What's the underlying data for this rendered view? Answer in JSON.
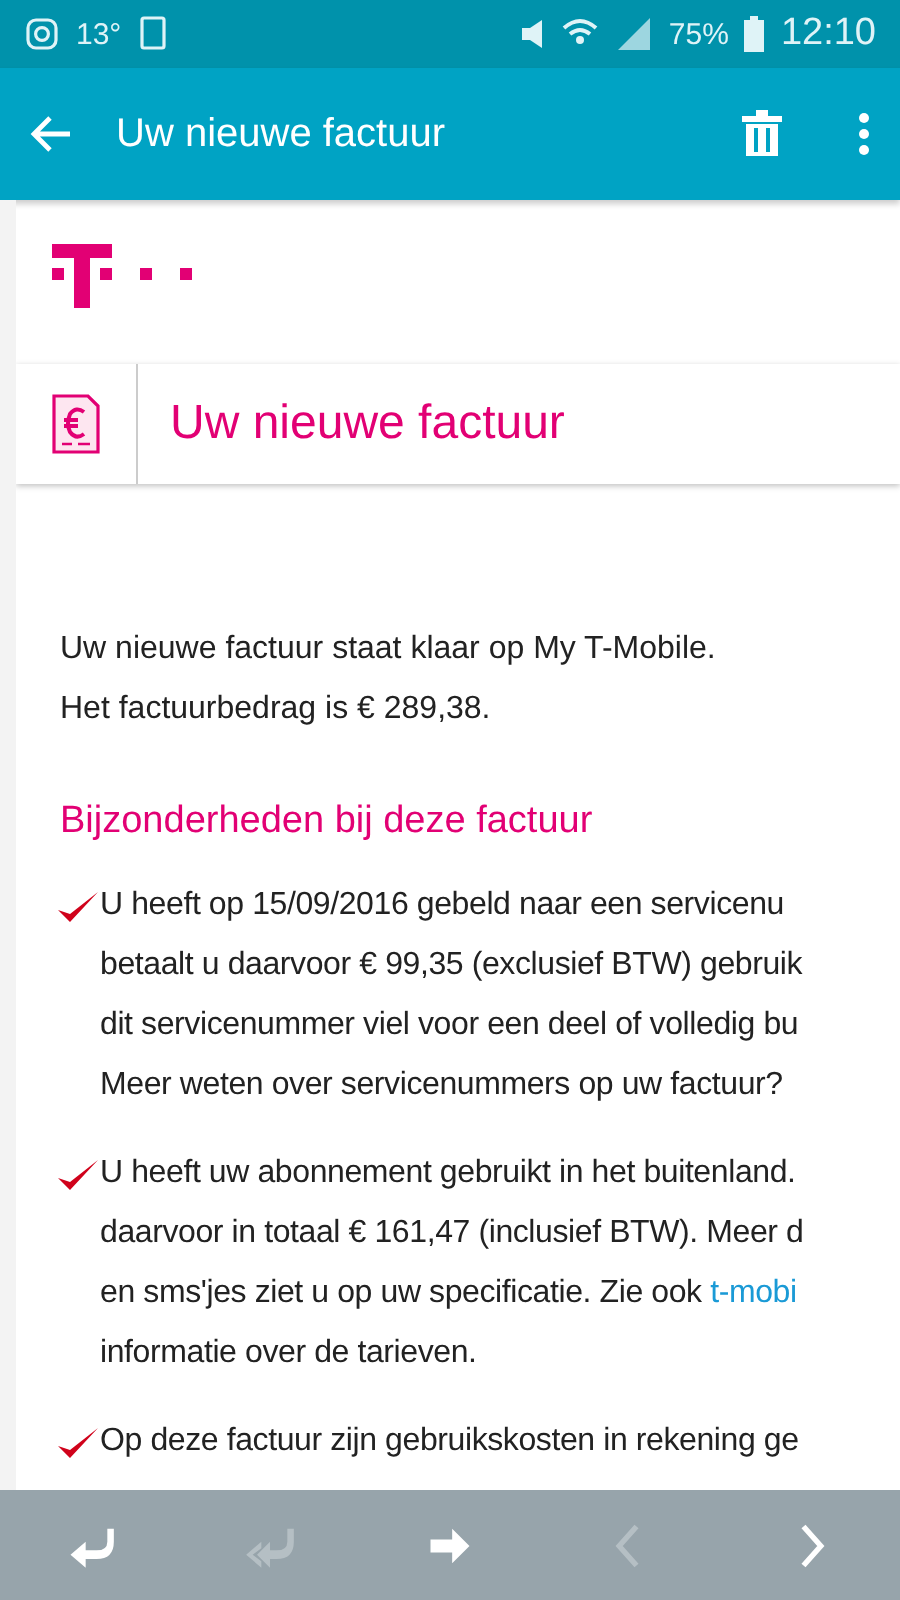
{
  "status_bar": {
    "temperature": "13°",
    "battery": "75%",
    "time": "12:10"
  },
  "app_bar": {
    "title": "Uw nieuwe factuur"
  },
  "email": {
    "header": "Uw nieuwe factuur",
    "intro": [
      "Uw nieuwe factuur staat klaar op My T-Mobile.",
      "Het factuurbedrag is € 289,38."
    ],
    "section_title": "Bijzonderheden bij deze factuur",
    "items": [
      {
        "lines": [
          {
            "text": "U heeft op 15/09/2016 gebeld naar een servicenu"
          },
          {
            "text": "betaalt u daarvoor € 99,35 (exclusief BTW) gebruik"
          },
          {
            "text": "dit servicenummer viel voor een deel of volledig bu"
          },
          {
            "text": "Meer weten over servicenummers op uw factuur?"
          }
        ]
      },
      {
        "lines": [
          {
            "text": "U heeft uw abonnement gebruikt in het buitenland."
          },
          {
            "text": "daarvoor in totaal € 161,47 (inclusief BTW). Meer d"
          },
          {
            "text": "en sms'jes ziet u op uw specificatie. Zie ook ",
            "link": "t-mobi"
          },
          {
            "text": "informatie over de tarieven."
          }
        ]
      },
      {
        "lines": [
          {
            "text": "Op deze factuur zijn gebruikskosten in rekening ge"
          }
        ]
      }
    ]
  },
  "bottom_bar": [
    {
      "kind": "reply",
      "disabled": false
    },
    {
      "kind": "reply-all",
      "disabled": true
    },
    {
      "kind": "forward",
      "disabled": false
    },
    {
      "kind": "previous",
      "disabled": true
    },
    {
      "kind": "next",
      "disabled": false
    }
  ]
}
